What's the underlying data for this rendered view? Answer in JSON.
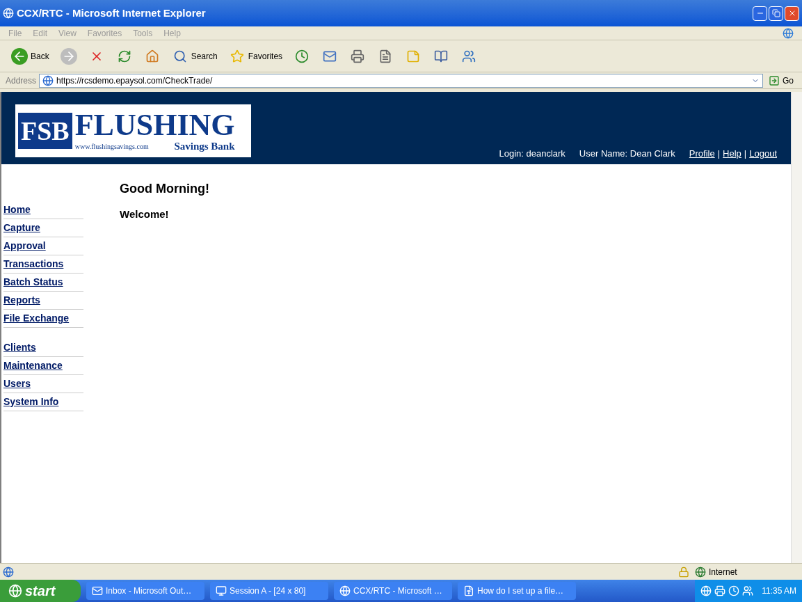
{
  "window": {
    "title": "CCX/RTC - Microsoft Internet Explorer"
  },
  "menu": [
    "File",
    "Edit",
    "View",
    "Favorites",
    "Tools",
    "Help"
  ],
  "toolbar": [
    {
      "kind": "back",
      "label": "Back"
    },
    {
      "kind": "forward"
    },
    {
      "kind": "stop"
    },
    {
      "kind": "refresh"
    },
    {
      "kind": "home"
    },
    {
      "kind": "search",
      "label": "Search"
    },
    {
      "kind": "favorites",
      "label": "Favorites"
    },
    {
      "kind": "history"
    },
    {
      "kind": "mail"
    },
    {
      "kind": "print"
    },
    {
      "kind": "edit"
    },
    {
      "kind": "note"
    },
    {
      "kind": "research"
    },
    {
      "kind": "messenger"
    }
  ],
  "address": {
    "label": "Address",
    "value": "https://rcsdemo.epaysol.com/CheckTrade/",
    "go": "Go"
  },
  "header": {
    "logo": {
      "badge": "FSB",
      "name": "FLUSHING",
      "url": "www.flushingsavings.com",
      "tagline": "Savings Bank"
    },
    "login": "Login: deanclark",
    "user_name": "User Name: Dean Clark",
    "links": [
      "Profile",
      "Help",
      "Logout"
    ],
    "link_separator": "|"
  },
  "nav": [
    [
      "Home",
      "Capture",
      "Approval",
      "Transactions",
      "Batch Status",
      "Reports",
      "File Exchange"
    ],
    [
      "Clients",
      "Maintenance",
      "Users",
      "System Info"
    ]
  ],
  "content": {
    "greeting": "Good Morning!",
    "welcome": "Welcome!"
  },
  "status_bar": {
    "zone": "Internet"
  },
  "taskbar": {
    "start": "start",
    "tasks": [
      "Inbox - Microsoft Out…",
      "Session A - [24 x 80]",
      "CCX/RTC - Microsoft …",
      "How do I set up a file…"
    ],
    "clock": "11:35 AM"
  }
}
